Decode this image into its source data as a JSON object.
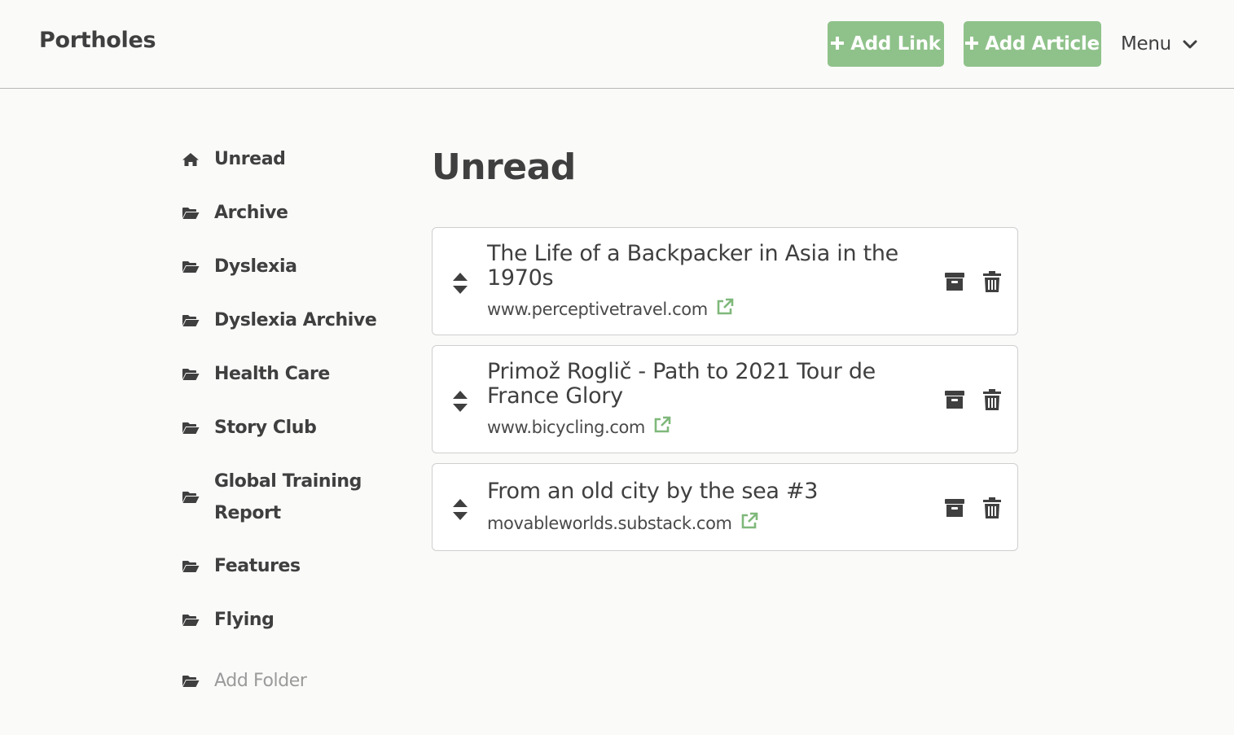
{
  "app": {
    "brand": "Portholes"
  },
  "header": {
    "add_link": "Add Link",
    "add_article": "Add Article",
    "plus_icon": "plus-icon",
    "menu_label": "Menu",
    "menu_icon": "chevron-down-icon"
  },
  "sidebar": {
    "items": [
      {
        "label": "Unread",
        "icon": "home-icon"
      },
      {
        "label": "Archive",
        "icon": "folder-open-icon"
      },
      {
        "label": "Dyslexia",
        "icon": "folder-open-icon"
      },
      {
        "label": "Dyslexia Archive",
        "icon": "folder-open-icon"
      },
      {
        "label": "Health Care",
        "icon": "folder-open-icon"
      },
      {
        "label": "Story Club",
        "icon": "folder-open-icon"
      },
      {
        "label": "Global Training Report",
        "icon": "folder-open-icon"
      },
      {
        "label": "Features",
        "icon": "folder-open-icon"
      },
      {
        "label": "Flying",
        "icon": "folder-open-icon"
      }
    ],
    "add_folder": "Add Folder"
  },
  "main": {
    "title": "Unread",
    "articles": [
      {
        "title": "The Life of a Backpacker in Asia in the 1970s",
        "site": "www.perceptivetravel.com"
      },
      {
        "title": "Primož Roglič - Path to 2021 Tour de France Glory",
        "site": "www.bicycling.com"
      },
      {
        "title": "From an old city by the sea #3",
        "site": "movableworlds.substack.com"
      }
    ]
  },
  "colors": {
    "accent": "#8fc28a",
    "external_link": "#7fb87a",
    "text": "#3f3f3f",
    "muted": "#9a9a9a",
    "background": "#fafaf9"
  }
}
